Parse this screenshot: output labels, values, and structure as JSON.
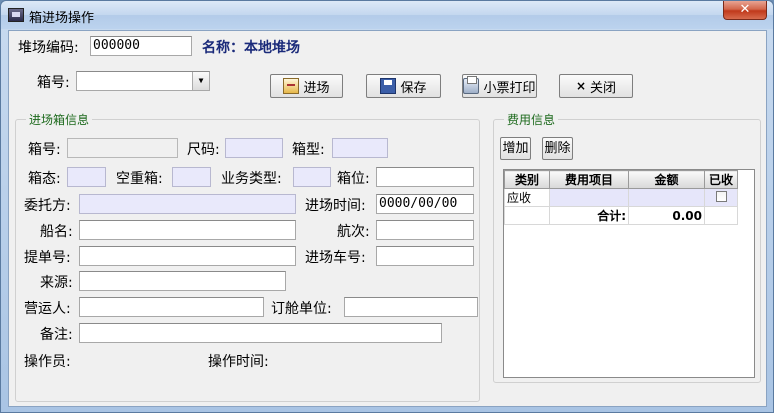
{
  "window": {
    "title": "箱进场操作",
    "close_symbol": "✕"
  },
  "header": {
    "yard_code_label": "堆场编码:",
    "yard_code_value": "000000",
    "name_label": "名称：本地堆场",
    "box_no_label": "箱号:",
    "box_no_value": ""
  },
  "toolbar": {
    "enter_label": "进场",
    "save_label": "保存",
    "print_label": "小票打印",
    "close_label": "关闭",
    "close_glyph": "×"
  },
  "entry_group": {
    "title": "进场箱信息",
    "box_no_label": "箱号:",
    "size_label": "尺码:",
    "type_label": "箱型:",
    "state_label": "箱态:",
    "empty_heavy_label": "空重箱:",
    "biz_type_label": "业务类型:",
    "slot_label": "箱位:",
    "client_label": "委托方:",
    "entry_time_label": "进场时间:",
    "entry_time_value": "0000/00/00",
    "ship_label": "船名:",
    "voyage_label": "航次:",
    "bl_label": "提单号:",
    "truck_label": "进场车号:",
    "source_label": "来源:",
    "carrier_label": "营运人:",
    "booking_label": "订舱单位:",
    "remark_label": "备注:",
    "operator_label": "操作员:",
    "operate_time_label": "操作时间:"
  },
  "fee_group": {
    "title": "费用信息",
    "add_label": "增加",
    "delete_label": "删除",
    "columns": [
      "类别",
      "费用项目",
      "金额",
      "已收"
    ],
    "rows": [
      {
        "category": "应收",
        "item": "",
        "amount": "",
        "received": false
      }
    ],
    "total_label": "合计:",
    "total_value": "0.00"
  }
}
